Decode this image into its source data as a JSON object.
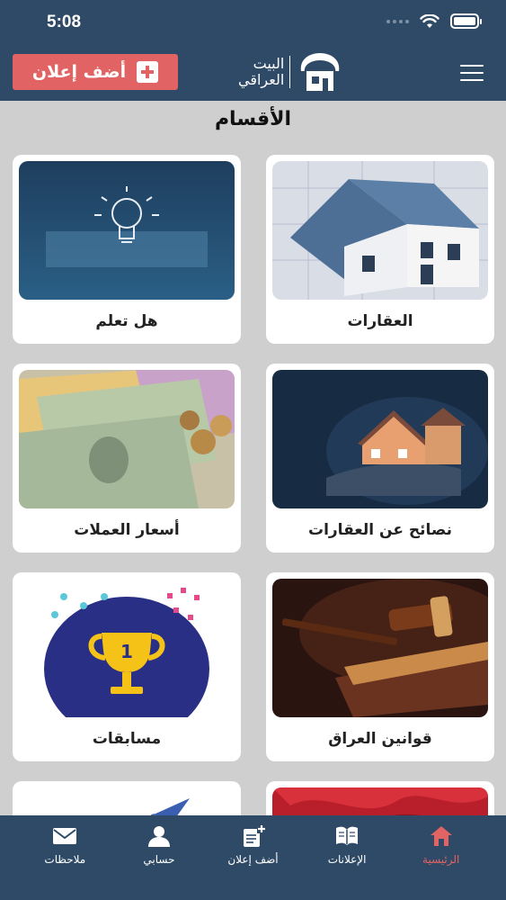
{
  "status_bar": {
    "time": "5:08"
  },
  "header": {
    "add_ad_label": "أضف إعلان",
    "logo_line1": "البيت",
    "logo_line2": "العراقي"
  },
  "section_title": "الأقسام",
  "categories": [
    {
      "label": "العقارات"
    },
    {
      "label": "هل تعلم"
    },
    {
      "label": "نصائح عن العقارات"
    },
    {
      "label": "أسعار العملات"
    },
    {
      "label": "قوانين العراق"
    },
    {
      "label": "مسابقات"
    },
    {
      "label": ""
    },
    {
      "label": ""
    }
  ],
  "bottom_nav": [
    {
      "label": "الرئيسية",
      "icon": "home-icon",
      "active": true
    },
    {
      "label": "الإعلانات",
      "icon": "book-icon",
      "active": false
    },
    {
      "label": "أضف إعلان",
      "icon": "add-post-icon",
      "active": false
    },
    {
      "label": "حسابي",
      "icon": "user-icon",
      "active": false
    },
    {
      "label": "ملاحظات",
      "icon": "mail-icon",
      "active": false
    }
  ],
  "colors": {
    "primary": "#2f4a66",
    "accent": "#e26363",
    "background": "#cfcfcf"
  }
}
